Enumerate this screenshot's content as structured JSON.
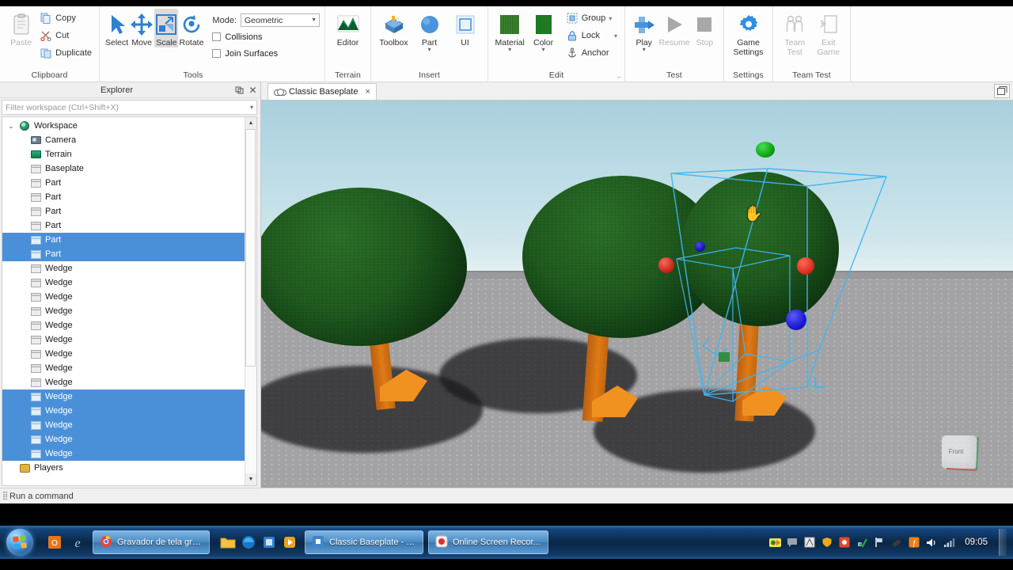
{
  "ribbon": {
    "groups": [
      {
        "label": "Clipboard",
        "paste": "Paste",
        "items": [
          {
            "label": "Copy",
            "icon": "copy-icon"
          },
          {
            "label": "Cut",
            "icon": "scissors-icon"
          },
          {
            "label": "Duplicate",
            "icon": "duplicate-icon"
          }
        ]
      },
      {
        "label": "Tools",
        "items": [
          {
            "label": "Select",
            "icon": "arrow-cursor-icon"
          },
          {
            "label": "Move",
            "icon": "move-arrows-icon"
          },
          {
            "label": "Scale",
            "icon": "scale-icon"
          },
          {
            "label": "Rotate",
            "icon": "rotate-icon"
          }
        ],
        "mode_label": "Mode:",
        "mode_value": "Geometric",
        "collisions": "Collisions",
        "join_surfaces": "Join Surfaces"
      },
      {
        "label": "Terrain",
        "items": [
          {
            "label": "Editor",
            "icon": "terrain-editor-icon"
          }
        ]
      },
      {
        "label": "Insert",
        "items": [
          {
            "label": "Toolbox",
            "icon": "toolbox-icon"
          },
          {
            "label": "Part",
            "icon": "part-sphere-icon"
          },
          {
            "label": "UI",
            "icon": "ui-frame-icon"
          }
        ]
      },
      {
        "label": "Edit",
        "items": [
          {
            "label": "Material",
            "icon": "material-grass-icon"
          },
          {
            "label": "Color",
            "icon": "color-swatch-icon"
          }
        ],
        "small_items": [
          {
            "label": "Group",
            "icon": "group-icon",
            "has_arrow": true
          },
          {
            "label": "Lock",
            "icon": "lock-icon",
            "has_arrow": true
          },
          {
            "label": "Anchor",
            "icon": "anchor-icon",
            "has_arrow": false
          }
        ]
      },
      {
        "label": "Test",
        "items": [
          {
            "label": "Play",
            "icon": "play-avatar-icon",
            "disabled": false
          },
          {
            "label": "Resume",
            "icon": "play-triangle-icon",
            "disabled": true
          },
          {
            "label": "Stop",
            "icon": "stop-square-icon",
            "disabled": true
          }
        ]
      },
      {
        "label": "Settings",
        "items": [
          {
            "label": "Game\nSettings",
            "line1": "Game",
            "line2": "Settings",
            "icon": "gear-icon"
          }
        ]
      },
      {
        "label": "Team Test",
        "items": [
          {
            "line1": "Team",
            "line2": "Test",
            "icon": "team-test-icon",
            "disabled": true
          },
          {
            "line1": "Exit",
            "line2": "Game",
            "icon": "exit-game-icon",
            "disabled": true
          }
        ]
      }
    ]
  },
  "explorer": {
    "title": "Explorer",
    "pin_icon": "pin-icon",
    "close_icon": "close-icon",
    "filter_placeholder": "Filter workspace (Ctrl+Shift+X)",
    "tree": [
      {
        "label": "Workspace",
        "icon": "globe-icon",
        "depth": 0,
        "expanded": true,
        "selected": false
      },
      {
        "label": "Camera",
        "icon": "camera-icon",
        "depth": 1,
        "selected": false
      },
      {
        "label": "Terrain",
        "icon": "terrain-icon",
        "depth": 1,
        "selected": false
      },
      {
        "label": "Baseplate",
        "icon": "brick-icon",
        "depth": 1,
        "selected": false
      },
      {
        "label": "Part",
        "icon": "brick-icon",
        "depth": 1,
        "selected": false
      },
      {
        "label": "Part",
        "icon": "brick-icon",
        "depth": 1,
        "selected": false
      },
      {
        "label": "Part",
        "icon": "brick-icon",
        "depth": 1,
        "selected": false
      },
      {
        "label": "Part",
        "icon": "brick-icon",
        "depth": 1,
        "selected": false
      },
      {
        "label": "Part",
        "icon": "brick-icon",
        "depth": 1,
        "selected": true
      },
      {
        "label": "Part",
        "icon": "brick-icon",
        "depth": 1,
        "selected": true
      },
      {
        "label": "Wedge",
        "icon": "brick-icon",
        "depth": 1,
        "selected": false
      },
      {
        "label": "Wedge",
        "icon": "brick-icon",
        "depth": 1,
        "selected": false
      },
      {
        "label": "Wedge",
        "icon": "brick-icon",
        "depth": 1,
        "selected": false
      },
      {
        "label": "Wedge",
        "icon": "brick-icon",
        "depth": 1,
        "selected": false
      },
      {
        "label": "Wedge",
        "icon": "brick-icon",
        "depth": 1,
        "selected": false
      },
      {
        "label": "Wedge",
        "icon": "brick-icon",
        "depth": 1,
        "selected": false
      },
      {
        "label": "Wedge",
        "icon": "brick-icon",
        "depth": 1,
        "selected": false
      },
      {
        "label": "Wedge",
        "icon": "brick-icon",
        "depth": 1,
        "selected": false
      },
      {
        "label": "Wedge",
        "icon": "brick-icon",
        "depth": 1,
        "selected": false
      },
      {
        "label": "Wedge",
        "icon": "brick-icon",
        "depth": 1,
        "selected": true
      },
      {
        "label": "Wedge",
        "icon": "brick-icon",
        "depth": 1,
        "selected": true
      },
      {
        "label": "Wedge",
        "icon": "brick-icon",
        "depth": 1,
        "selected": true
      },
      {
        "label": "Wedge",
        "icon": "brick-icon",
        "depth": 1,
        "selected": true
      },
      {
        "label": "Wedge",
        "icon": "brick-icon",
        "depth": 1,
        "selected": true
      },
      {
        "label": "Players",
        "icon": "players-icon",
        "depth": 0,
        "selected": false
      }
    ],
    "selection_color": "#4a90d9"
  },
  "viewport": {
    "tab_label": "Classic Baseplate",
    "tab_icon": "cloud-icon",
    "tab_close": "×",
    "layout_button_icon": "layout-icon",
    "viewcube_label": "Front",
    "cursor_icon": "hand-cursor-icon",
    "sky_color": "#b6d6e2",
    "ground_color": "#a3a3a6",
    "selection_outline_color": "#3fb6f0",
    "handles": [
      {
        "name": "scale-handle-top",
        "color": "#12a81a"
      },
      {
        "name": "scale-handle-right",
        "color": "#e03227"
      },
      {
        "name": "scale-handle-front",
        "color": "#1a1ad2"
      },
      {
        "name": "scale-handle-left",
        "color": "#c02a20"
      },
      {
        "name": "scale-handle-back",
        "color": "#1616b4"
      }
    ],
    "tree_trunk_color": "#d9760f",
    "tree_canopy_color": "#1d5a1c"
  },
  "command_bar": {
    "placeholder": "Run a command",
    "grip_icon": "drag-grip-icon"
  },
  "taskbar": {
    "start_label": "Start",
    "start_icon": "windows-orb-icon",
    "quick_launch": [
      {
        "name": "office-icon"
      },
      {
        "name": "internet-explorer-icon"
      }
    ],
    "windows": [
      {
        "label": "Gravador de tela grát...",
        "icon": "chrome-icon",
        "active": true
      },
      {
        "label": "Classic Baseplate - R...",
        "icon": "roblox-studio-icon",
        "active": true
      },
      {
        "label": "Online Screen Recor...",
        "icon": "recorder-icon",
        "active": true
      }
    ],
    "pinned_after": [
      {
        "name": "explorer-folder-icon"
      },
      {
        "name": "edge-icon"
      },
      {
        "name": "store-icon"
      },
      {
        "name": "media-icon"
      },
      {
        "name": "vlc-icon"
      }
    ],
    "tray": [
      {
        "name": "tray-media-icon"
      },
      {
        "name": "tray-chat-icon"
      },
      {
        "name": "tray-tools-icon"
      },
      {
        "name": "tray-shield-icon"
      },
      {
        "name": "tray-record-icon"
      },
      {
        "name": "tray-check-icon"
      },
      {
        "name": "tray-flag-icon"
      },
      {
        "name": "tray-printer-icon"
      },
      {
        "name": "tray-update-icon"
      },
      {
        "name": "volume-icon"
      },
      {
        "name": "network-icon"
      }
    ],
    "clock": "09:05",
    "show_desktop_icon": "show-desktop-button"
  }
}
